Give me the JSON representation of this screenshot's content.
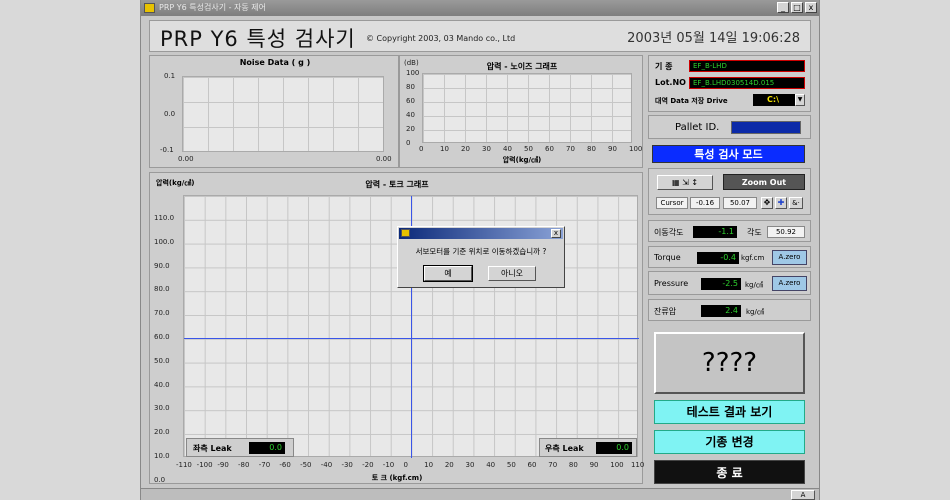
{
  "window": {
    "title": "PRP Y6 특성검사기 - 자동 제어",
    "minimize": "_",
    "maximize": "□",
    "close": "x"
  },
  "header": {
    "title": "PRP Y6 특성 검사기",
    "copyright": "© Copyright 2003, 03  Mando co., Ltd",
    "datetime": "2003년 05월 14일   19:06:28"
  },
  "noise_chart": {
    "title": "Noise Data ( g )",
    "y_ticks": [
      "0.1",
      "0.0",
      "-0.1"
    ],
    "x_ticks": [
      "0.00",
      "0.00"
    ]
  },
  "pressure_noise_chart": {
    "title": "압력 - 노이즈 그래프",
    "y_unit": "(dB)",
    "y_ticks": [
      "100",
      "80",
      "60",
      "40",
      "20",
      "0"
    ],
    "x_ticks": [
      "0",
      "10",
      "20",
      "30",
      "40",
      "50",
      "60",
      "70",
      "80",
      "90",
      "100"
    ],
    "xlabel": "압력(kg/㎠)"
  },
  "torque_chart": {
    "title": "압력 - 토크 그래프",
    "ylabel": "압력(kg/㎠)",
    "xlabel": "토  크 (kgf.cm)",
    "y_ticks": [
      "110.0",
      "100.0",
      "90.0",
      "80.0",
      "70.0",
      "60.0",
      "50.0",
      "40.0",
      "30.0",
      "20.0",
      "10.0",
      "0.0"
    ],
    "x_ticks": [
      "-110",
      "-100",
      "-90",
      "-80",
      "-70",
      "-60",
      "-50",
      "-40",
      "-30",
      "-20",
      "-10",
      "0",
      "10",
      "20",
      "30",
      "40",
      "50",
      "60",
      "70",
      "80",
      "90",
      "100",
      "110"
    ],
    "left_leak_label": "좌측 Leak",
    "left_leak_value": "0.0",
    "right_leak_label": "우측 Leak",
    "right_leak_value": "0.0"
  },
  "info": {
    "model_label": "기  종",
    "model_value": "EF_B-LHD",
    "lot_label": "Lot.NO",
    "lot_value": "EF_B.LHD030514D.015",
    "drive_label": "대역 Data 저장 Drive",
    "drive_value": "C:\\"
  },
  "pallet": {
    "label": "Pallet ID."
  },
  "mode": {
    "label": "특성 검사 모드"
  },
  "zoom": {
    "zoom_out": "Zoom Out",
    "cursor_label": "Cursor",
    "cursor_x": "-0.16",
    "cursor_y": "50.07"
  },
  "readings": {
    "angle_label": "이동각도",
    "angle_value": "-1.1",
    "angle2_label": "각도",
    "angle2_value": "50.92",
    "torque_label": "Torque",
    "torque_value": "-0.4",
    "torque_unit": "kgf.cm",
    "pressure_label": "Pressure",
    "pressure_value": "-2.5",
    "pressure_unit": "kg/㎠",
    "azero": "A.zero",
    "residual_label": "잔류압",
    "residual_value": "2.4",
    "residual_unit": "kg/㎠"
  },
  "result": {
    "display": "????"
  },
  "buttons": {
    "view_results": "테스트 결과 보기",
    "change_model": "기종 변경",
    "exit": "종   료"
  },
  "dialog": {
    "message": "서보모터를 기준 위치로 이동하겠습니까 ?",
    "yes": "예",
    "no": "아니오",
    "close": "x"
  },
  "statusbar": {
    "indicator": "A"
  },
  "colors": {
    "lcd_text": "#2ed12e",
    "mode_bg": "#0a2cff",
    "cyan_button": "#7ff3f3",
    "crosshair": "#3a55e8"
  }
}
